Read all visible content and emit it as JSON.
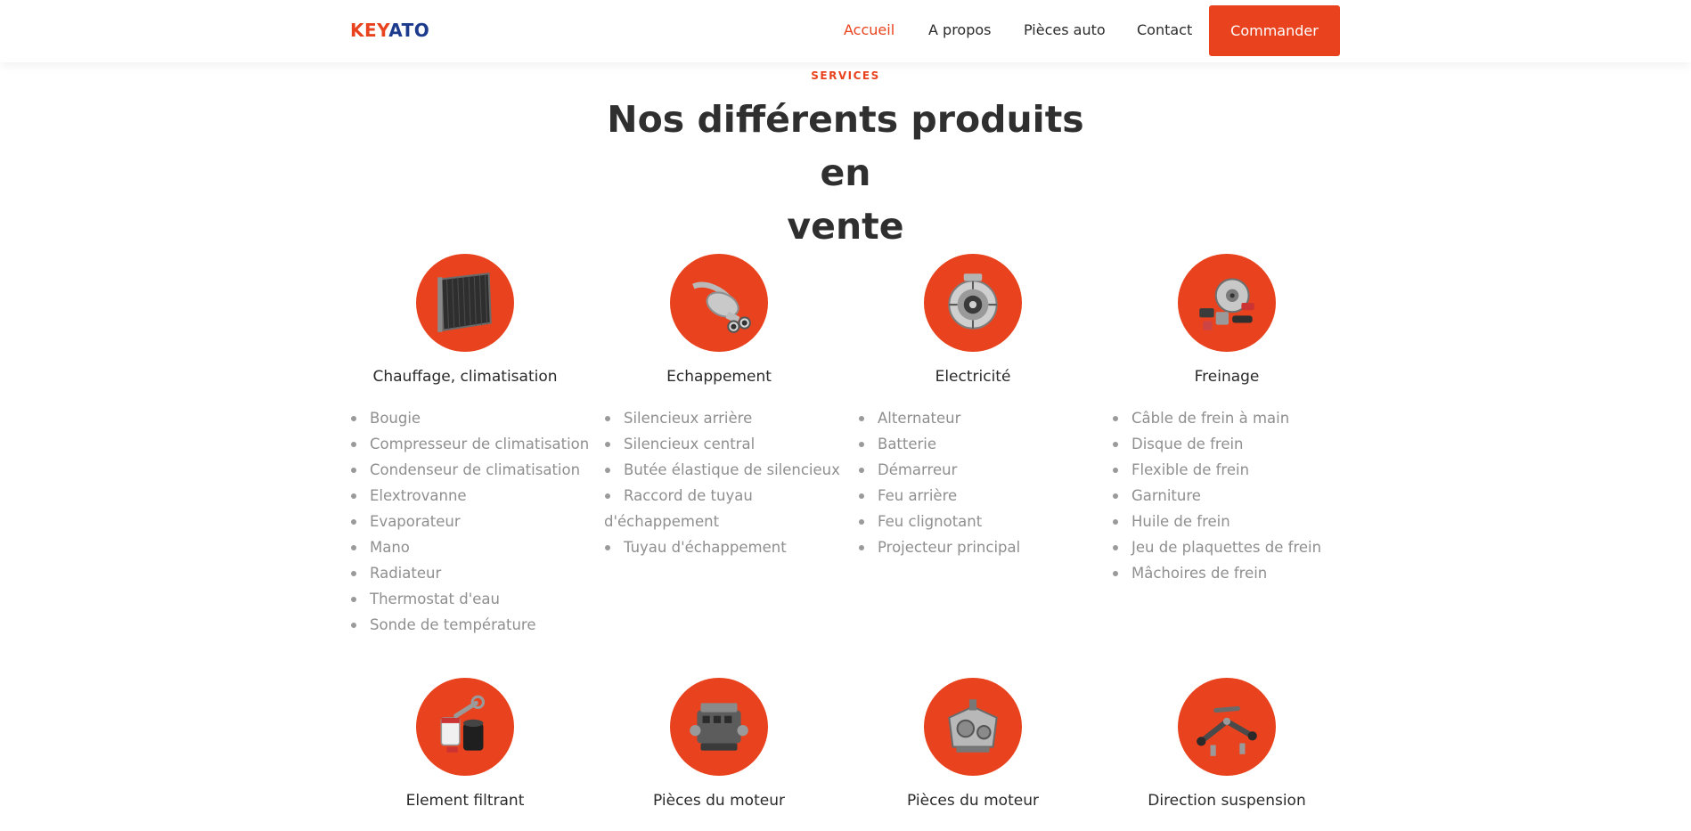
{
  "brand": {
    "part1": "KEY",
    "part2": "ATO"
  },
  "nav": {
    "items": [
      {
        "label": "Accueil",
        "active": true
      },
      {
        "label": "A propos",
        "active": false
      },
      {
        "label": "Pièces auto",
        "active": false
      },
      {
        "label": "Contact",
        "active": false
      }
    ],
    "cta_label": "Commander"
  },
  "section": {
    "eyebrow": "SERVICES",
    "title_line1": "Nos différents produits en",
    "title_line2": "vente"
  },
  "products": [
    {
      "title": "Chauffage, climatisation",
      "icon": "radiator-icon",
      "items": [
        "Bougie",
        "Compresseur de climatisation",
        "Condenseur de climatisation",
        "Elextrovanne",
        "Evaporateur",
        "Mano",
        "Radiateur",
        "Thermostat d'eau",
        "Sonde de température"
      ]
    },
    {
      "title": "Echappement",
      "icon": "muffler-icon",
      "items": [
        "Silencieux arrière",
        "Silencieux central",
        "Butée élastique de silencieux",
        "Raccord de tuyau d'échappement",
        "Tuyau d'échappement"
      ]
    },
    {
      "title": "Electricité",
      "icon": "alternator-icon",
      "items": [
        "Alternateur",
        "Batterie",
        "Démarreur",
        "Feu arrière",
        "Feu clignotant",
        "Projecteur principal"
      ]
    },
    {
      "title": "Freinage",
      "icon": "brake-disc-icon",
      "items": [
        "Câble de frein à main",
        "Disque de frein",
        "Flexible de frein",
        "Garniture",
        "Huile de frein",
        "Jeu de plaquettes de frein",
        "Mâchoires de frein"
      ]
    },
    {
      "title": "Element filtrant",
      "icon": "oil-filter-icon",
      "items": []
    },
    {
      "title": "Pièces du moteur",
      "icon": "engine-icon",
      "items": []
    },
    {
      "title": "Pièces du moteur",
      "icon": "gearbox-icon",
      "items": []
    },
    {
      "title": "Direction suspension",
      "icon": "suspension-arm-icon",
      "items": []
    }
  ],
  "colors": {
    "accent": "#e8431e",
    "brand_blue": "#1d3b8c",
    "text": "#2f2f2f",
    "muted": "#8f8f8f"
  }
}
